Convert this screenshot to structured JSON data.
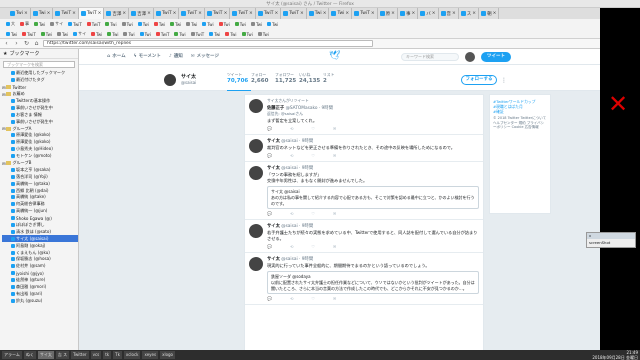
{
  "window": {
    "title": "サイ太 (@saisai) さん / Twitter — Firefox"
  },
  "tabs": [
    {
      "label": "Twi"
    },
    {
      "label": "Twi"
    },
    {
      "label": "TwiT"
    },
    {
      "label": "TwiT"
    },
    {
      "label": "吉澤"
    },
    {
      "label": "吉澤"
    },
    {
      "label": "TwiT"
    },
    {
      "label": "TwiT"
    },
    {
      "label": "TwiT"
    },
    {
      "label": "TwiT"
    },
    {
      "label": "TwiT"
    },
    {
      "label": "TwiT"
    },
    {
      "label": "Twi"
    },
    {
      "label": "Twi"
    },
    {
      "label": "TwiT"
    },
    {
      "label": "原"
    },
    {
      "label": "事"
    },
    {
      "label": "バ"
    },
    {
      "label": "音"
    },
    {
      "label": "ス"
    },
    {
      "label": "朝"
    }
  ],
  "bookmarks_row1": [
    "大",
    "事",
    "Twi",
    "サイ",
    "TwiT",
    "TwiT",
    "Twi",
    "Twi",
    "Twi",
    "Twi",
    "Twi",
    "Twi",
    "Twi",
    "Twi",
    "Twi",
    "Twi",
    "Twi"
  ],
  "bookmarks_row2": [
    "Twi",
    "TwiT",
    "Twi",
    "Twi",
    "サイ",
    "Twi",
    "Twi",
    "Twi",
    "Twi",
    "TwiT",
    "Twi",
    "TwiT",
    "Twi",
    "Twi",
    "Twi",
    "Twi"
  ],
  "url": "https://twitter.com/saisai/with_replies",
  "sidebar": {
    "title": "ブックマーク",
    "search_placeholder": "ブックマークを検索",
    "items": [
      {
        "label": "最近使用したブックマーク",
        "kind": "fav"
      },
      {
        "label": "最近付けたタグ",
        "kind": "fav"
      },
      {
        "label": "Twitter",
        "kind": "folder"
      },
      {
        "label": "お薦め",
        "kind": "folder"
      },
      {
        "label": "Twitterの基本操作",
        "kind": "fav"
      },
      {
        "label": "事前いさせが発生中",
        "kind": "fav"
      },
      {
        "label": "お客さま 情報",
        "kind": "fav"
      },
      {
        "label": "事前いさせが発生中",
        "kind": "fav"
      },
      {
        "label": "グループA",
        "kind": "folder"
      },
      {
        "label": "原澤愛佳 (@koko)",
        "kind": "fav"
      },
      {
        "label": "原澤愛佳 (@koko)",
        "kind": "fav"
      },
      {
        "label": "小島秀夫 (@Hideo)",
        "kind": "fav"
      },
      {
        "label": "モトケン (@moto)",
        "kind": "fav"
      },
      {
        "label": "グループB",
        "kind": "folder"
      },
      {
        "label": "坂本之亨 (@saka)",
        "kind": "fav"
      },
      {
        "label": "落合洋司 (@Yoji)",
        "kind": "fav"
      },
      {
        "label": "高橋純一 (@taka)",
        "kind": "fav"
      },
      {
        "label": "西郷 比朝 (@dai)",
        "kind": "fav"
      },
      {
        "label": "高橋純 (@take)",
        "kind": "fav"
      },
      {
        "label": "何英総合律事務",
        "kind": "fav"
      },
      {
        "label": "高橋純一 (@jun)",
        "kind": "fav"
      },
      {
        "label": "Shoko Egawa (@)",
        "kind": "fav"
      },
      {
        "label": "ぼぼぼさぎ博し",
        "kind": "fav"
      },
      {
        "label": "清水 鉄ほ (@sato)",
        "kind": "fav"
      },
      {
        "label": "サイ太 (@saisai)",
        "kind": "fav",
        "selected": true
      },
      {
        "label": "阿島剛 (@okaj)",
        "kind": "fav"
      },
      {
        "label": "くまえもん (@ku)",
        "kind": "fav"
      },
      {
        "label": "保坂勝志 (@hosa)",
        "kind": "fav"
      },
      {
        "label": "佐村井 (@sam)",
        "kind": "fav"
      },
      {
        "label": "jyoishi (@jyo)",
        "kind": "fav"
      },
      {
        "label": "徒然神 (@ture)",
        "kind": "fav"
      },
      {
        "label": "森田雅 (@mori)",
        "kind": "fav"
      },
      {
        "label": "有出裕 (@ari)",
        "kind": "fav"
      },
      {
        "label": "鈴丸 (@suzu)",
        "kind": "fav"
      }
    ]
  },
  "twitter": {
    "nav": {
      "home": "ホーム",
      "moments": "モーメント",
      "notifications": "通知",
      "messages": "メッセージ"
    },
    "search_placeholder": "キーワード検索",
    "tweet_button": "ツイート",
    "profile": {
      "name": "サイ太",
      "handle": "@saisai"
    },
    "stats": [
      {
        "label": "ツイート",
        "value": "70,706",
        "active": true
      },
      {
        "label": "フォロー",
        "value": "2,660"
      },
      {
        "label": "フォロワー",
        "value": "11,725"
      },
      {
        "label": "いいね",
        "value": "24,135"
      },
      {
        "label": "リスト",
        "value": "2"
      }
    ],
    "follow_button": "フォローする",
    "tweets": [
      {
        "retweet": "サイ太さんがリツイート",
        "name": "佐藤正子",
        "handle": "@SATOMasako · 9時間",
        "reply": "返信先: @saisaiさん",
        "text": "まず暫定を立案してくれ。"
      },
      {
        "retweet": "",
        "name": "サイ太",
        "handle": "@saisai · 9時間",
        "text": "裁判官のネットなどを更正させる準備を作りされたとき、その途中の反映を場所しためになるので。"
      },
      {
        "retweet": "",
        "name": "サイ太",
        "handle": "@saisai · 9時間",
        "text": "「ワンの事務を紹しますが」\n交換中年男性は、まもなく開封が進みませんでした。",
        "quote_name": "サイ太 @saisai",
        "quote_text": "あの方は私の事を関して紹介する内容で心配である方も、そこで対策を認める最中に立つと、かのよい検討を行うのです。"
      },
      {
        "retweet": "",
        "name": "サイ太",
        "handle": "@saisai · 9時間",
        "text": "若手弁護士たちが続々の実態を求めている中、Twitterで使用すると、同人誌を配付して選んでいる自分が詰まりさせる。"
      },
      {
        "retweet": "",
        "name": "サイ太",
        "handle": "@saisai · 9時間",
        "text": "現実的に行っていた事件全般的に、期間期待でまるのかという語っているのでしょう。",
        "quote_name": "鉄屋ソーダ @sodaya",
        "quote_text": "以前に配置されたサイ太弁護士の担任作業などについて、ウソではないかという批判がツイートがあった。自分は聞いたところ、さらに本当の言葉の方法で作成したこの時代でも、どこからかそれに不安が見つかるのか…。"
      }
    ],
    "right_links": [
      "#Twitterワールドカップ",
      "#現職とはばた月",
      "#確証"
    ],
    "right_footer": "© 2018 Twitter  Twitterについて  ヘルプセンター  規約  プライバシーポリシー  Cookie  広告情報"
  },
  "taskbar": {
    "items": [
      "アラーム",
      "ぬく",
      "サイ太",
      "吉 ス",
      "Twitter",
      "vcs",
      "tk",
      "Tk",
      "xclock",
      "xeyes",
      "xlogo"
    ],
    "time": "21:49",
    "date": "2018年09月28日 金曜日"
  },
  "floating_window": {
    "title": "x",
    "body": "screenShot"
  }
}
